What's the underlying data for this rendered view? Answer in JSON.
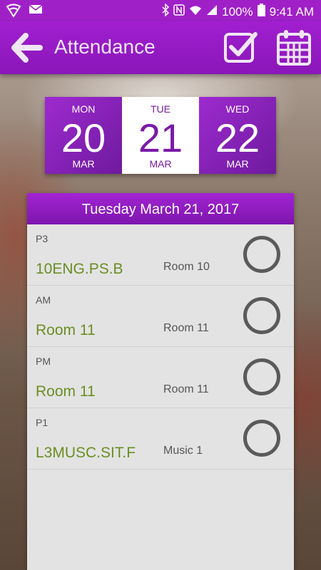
{
  "status_bar": {
    "battery": "100%",
    "time": "9:41 AM"
  },
  "app_bar": {
    "title": "Attendance"
  },
  "date_strip": [
    {
      "dow": "MON",
      "day": "20",
      "month": "MAR",
      "selected": false
    },
    {
      "dow": "TUE",
      "day": "21",
      "month": "MAR",
      "selected": true
    },
    {
      "dow": "WED",
      "day": "22",
      "month": "MAR",
      "selected": false
    }
  ],
  "panel": {
    "header": "Tuesday March 21, 2017",
    "rows": [
      {
        "period": "P3",
        "class": "10ENG.PS.B",
        "room": "Room 10"
      },
      {
        "period": "AM",
        "class": "Room 11",
        "room": "Room 11"
      },
      {
        "period": "PM",
        "class": "Room 11",
        "room": "Room 11"
      },
      {
        "period": "P1",
        "class": "L3MUSC.SIT.F",
        "room": "Music 1"
      }
    ]
  },
  "colors": {
    "accent": "#a020c8",
    "class_text": "#6b8e23"
  }
}
